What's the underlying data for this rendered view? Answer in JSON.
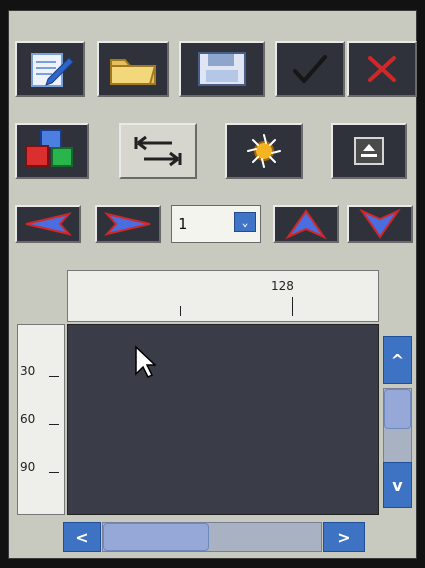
{
  "toolbar_row1": {
    "buttons": [
      {
        "icon": "edit-icon"
      },
      {
        "icon": "folder-icon"
      },
      {
        "icon": "save-icon"
      },
      {
        "icon": "check-icon"
      },
      {
        "icon": "close-icon"
      }
    ]
  },
  "toolbar_row2": {
    "buttons": [
      {
        "icon": "cubes-icon"
      },
      {
        "icon": "swap-arrows-icon"
      },
      {
        "icon": "burst-icon"
      },
      {
        "icon": "eject-icon"
      }
    ]
  },
  "navigation": {
    "spinner_value": "1",
    "buttons": [
      {
        "icon": "left-arrow-icon"
      },
      {
        "icon": "right-arrow-icon"
      },
      {
        "icon": "up-arrow-icon"
      },
      {
        "icon": "down-arrow-icon"
      }
    ]
  },
  "ruler": {
    "top_label": "128",
    "left_labels": [
      "30",
      "60",
      "90"
    ]
  },
  "scroll": {
    "up_label": "^",
    "down_label": "v",
    "left_label": "<",
    "right_label": ">"
  },
  "colors": {
    "background": "#c8cac0",
    "dark_button": "#2f323a",
    "plot": "#3a3d48",
    "blue": "#3e73c4",
    "red": "#d02828"
  }
}
